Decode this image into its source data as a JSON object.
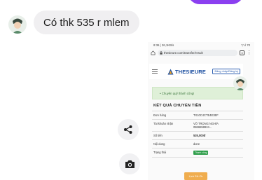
{
  "chat": {
    "message_text": "Có thk 535 r mlem",
    "share_icon": "share-icon",
    "camera_icon": "camera-icon"
  },
  "phone": {
    "status_time": "8:36 | 26,1KB/s",
    "status_right": "▽.ıl 70",
    "url": "thesieure.com/transfer/result",
    "tab_count": "3",
    "logo_text": "THESIEURE",
    "login_label": "Đăng nhập/Đăng ký",
    "success_message": "Chuyển quỹ thành công!",
    "result_title": "KẾT QUẢ CHUYỂN TIỀN",
    "rows": [
      {
        "label": "Đơn hàng",
        "value": "TX10C4CTE4E3EF"
      },
      {
        "label": "Tài khoản nhận",
        "value": "VÕ TRỌNG NGHĨA",
        "value2": "0866558924..."
      },
      {
        "label": "Số tiền",
        "value": "535,000đ"
      },
      {
        "label": "Nội dung",
        "value": "done"
      },
      {
        "label": "Trạng thái",
        "value": "Thành công"
      }
    ],
    "back_button_label": "Lịch Sử Ck",
    "colors": {
      "success_bg": "#dff0d8",
      "badge": "#2e9e4a",
      "button": "#f0ad4e",
      "logo": "#1b4ea0"
    }
  }
}
